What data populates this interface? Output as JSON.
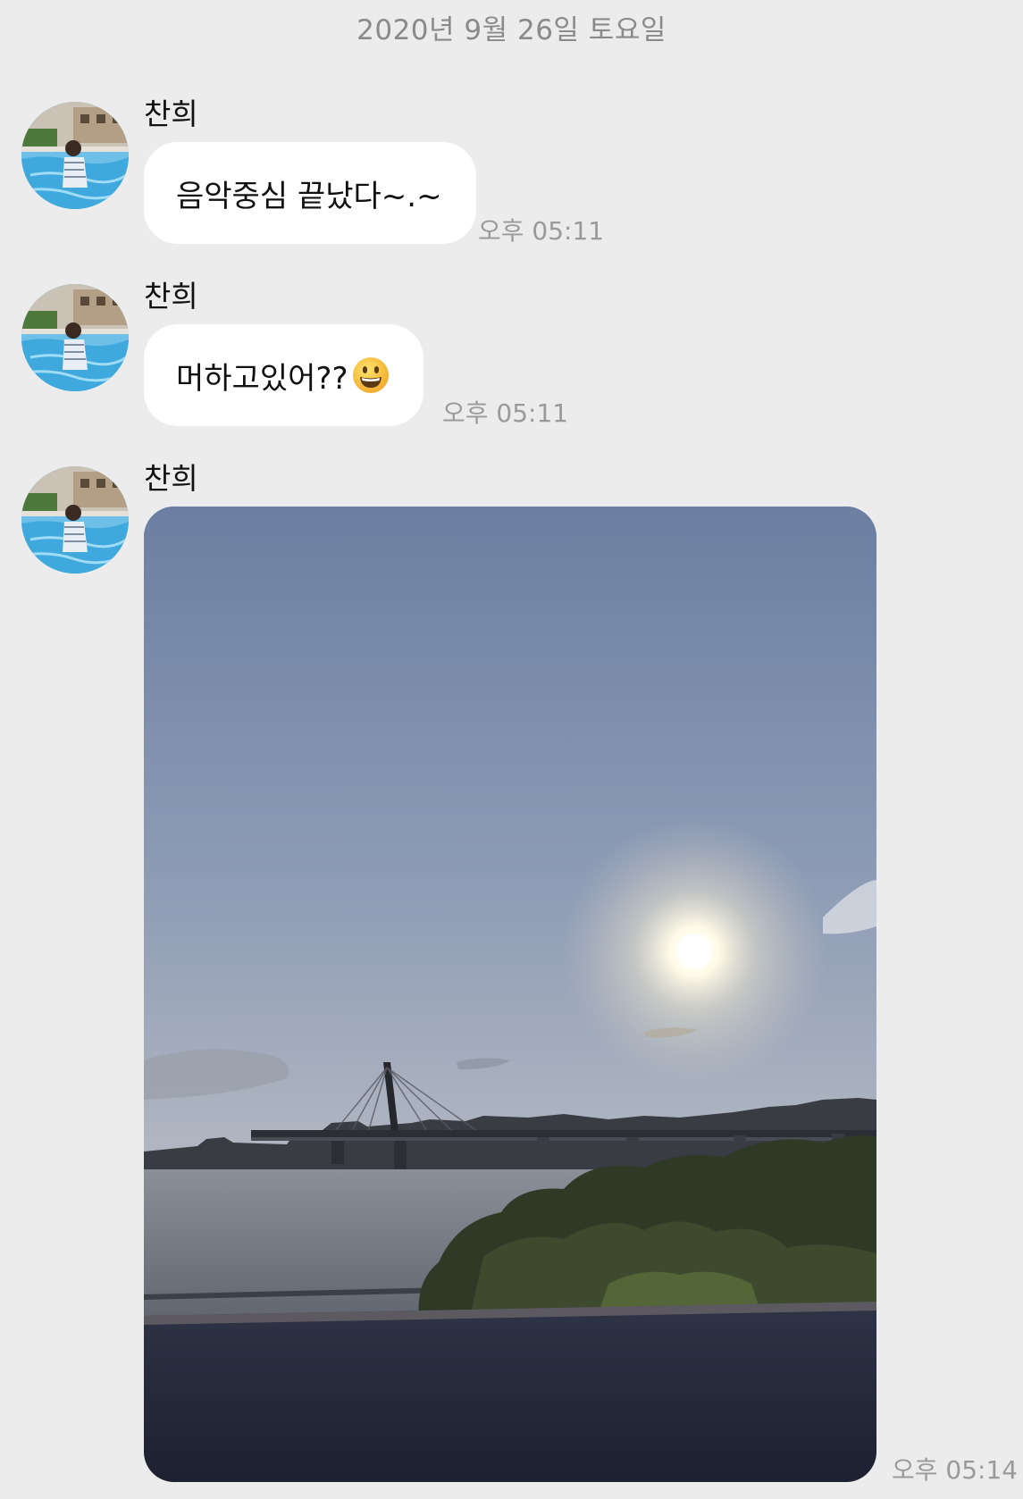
{
  "date_divider": "2020년 9월 26일 토요일",
  "messages": [
    {
      "sender": "찬희",
      "text": "음악중심 끝났다~.~",
      "time": "오후 05:11"
    },
    {
      "sender": "찬희",
      "text": "머하고있어??",
      "emoji": "grinning-face-emoji",
      "time": "오후 05:11"
    },
    {
      "sender": "찬희",
      "image": "sunset-river-bridge-photo",
      "time": "오후 05:14"
    }
  ]
}
